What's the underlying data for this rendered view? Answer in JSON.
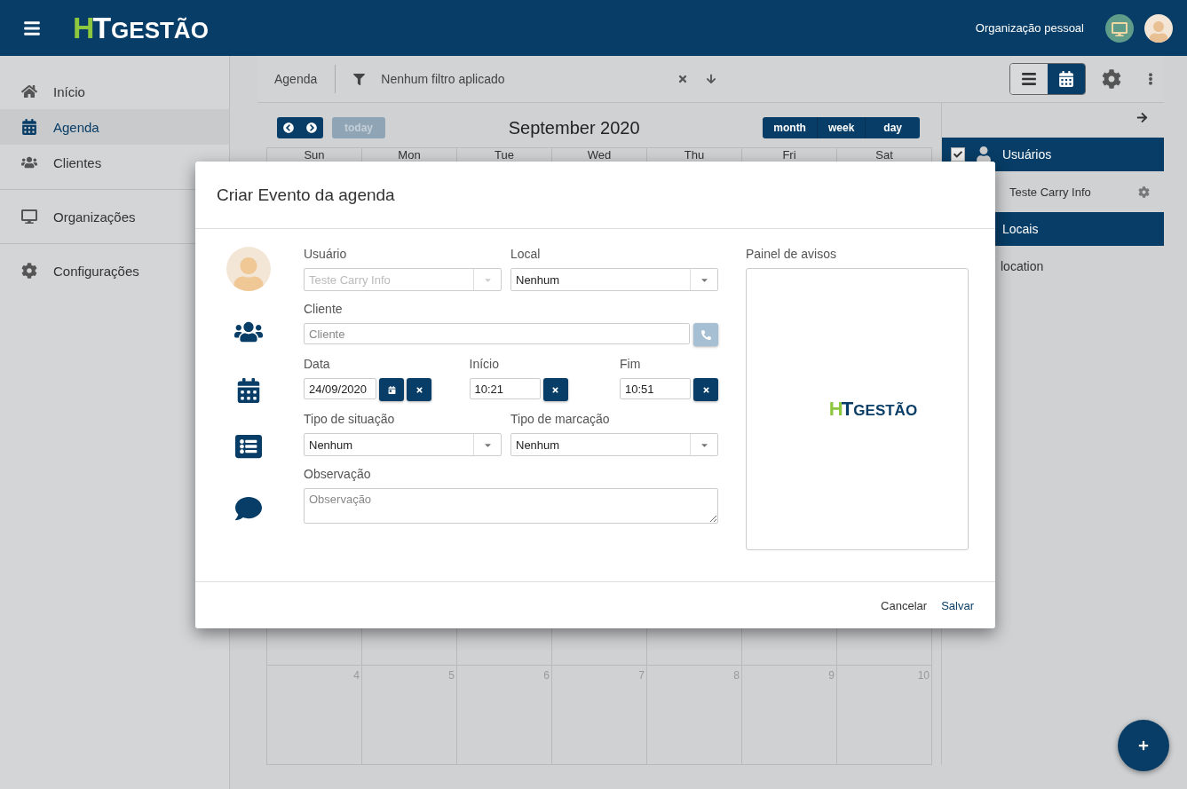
{
  "header": {
    "logo": {
      "accent": "H",
      "mark": "T",
      "name": "GESTÃO"
    },
    "organization": "Organização pessoal"
  },
  "sidebar": {
    "items": [
      {
        "label": "Início",
        "selected": false,
        "divider_after": false
      },
      {
        "label": "Agenda",
        "selected": true,
        "divider_after": false
      },
      {
        "label": "Clientes",
        "selected": false,
        "divider_after": true
      },
      {
        "label": "Organizações",
        "selected": false,
        "divider_after": true
      },
      {
        "label": "Configurações",
        "selected": false,
        "divider_after": false
      }
    ]
  },
  "toolbar": {
    "title": "Agenda",
    "filter": "Nenhum filtro aplicado",
    "views": [
      {
        "selected": false
      },
      {
        "selected": true
      }
    ]
  },
  "calendar": {
    "today": "today",
    "month_title": "September 2020",
    "views": [
      "month",
      "week",
      "day"
    ],
    "weekdays": [
      "Sun",
      "Mon",
      "Tue",
      "Wed",
      "Thu",
      "Fri",
      "Sat"
    ],
    "visible_week": [
      "4",
      "5",
      "6",
      "7",
      "8",
      "9",
      "10"
    ]
  },
  "right_panel": {
    "sections": [
      {
        "title": "Usuários",
        "checked": true,
        "items": [
          {
            "label": "Teste Carry Info"
          }
        ]
      },
      {
        "title": "Locais",
        "items": [
          {
            "label": "location"
          }
        ]
      }
    ]
  },
  "dialog": {
    "title": "Criar Evento da agenda",
    "usuario": {
      "label": "Usuário",
      "value": "Teste Carry Info",
      "disabled": true
    },
    "local": {
      "label": "Local",
      "value": "Nenhum",
      "disabled": false
    },
    "cliente": {
      "label": "Cliente",
      "placeholder": "Cliente"
    },
    "data": {
      "label": "Data",
      "value": "24/09/2020"
    },
    "inicio": {
      "label": "Início",
      "value": "10:21"
    },
    "fim": {
      "label": "Fim",
      "value": "10:51"
    },
    "situacao": {
      "label": "Tipo de situação",
      "value": "Nenhum",
      "disabled": false
    },
    "marcacao": {
      "label": "Tipo de marcação",
      "value": "Nenhum",
      "disabled": false
    },
    "observacao": {
      "label": "Observação",
      "placeholder": "Observação"
    },
    "notice_board": {
      "label": "Painel de avisos",
      "logo": {
        "accent": "H",
        "mark": "T",
        "name": "GESTÃO"
      }
    },
    "buttons": [
      {
        "label": "Cancelar",
        "primary": false
      },
      {
        "label": "Salvar",
        "primary": true
      }
    ]
  }
}
